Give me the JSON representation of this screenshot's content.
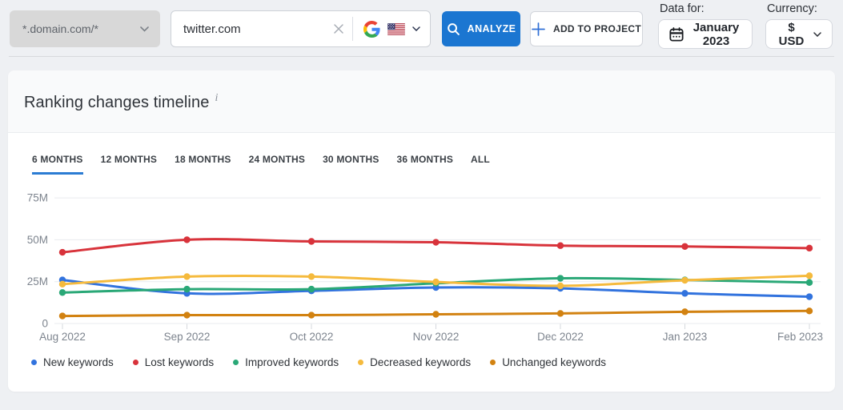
{
  "topbar": {
    "domain_filter": {
      "value": "*.domain.com/*"
    },
    "search": {
      "value": "twitter.com"
    },
    "search_engine": {
      "engine_icon": "google-icon",
      "region_icon": "us-flag-icon"
    },
    "analyze_button": "ANALYZE",
    "add_to_project_button": "ADD TO PROJECT",
    "data_for": {
      "label": "Data for:",
      "value": "January 2023"
    },
    "currency": {
      "label": "Currency:",
      "value": "$ USD"
    }
  },
  "panel": {
    "title": "Ranking changes timeline",
    "info_mark": "i",
    "tabs": [
      {
        "label": "6 MONTHS",
        "active": true
      },
      {
        "label": "12 MONTHS",
        "active": false
      },
      {
        "label": "18 MONTHS",
        "active": false
      },
      {
        "label": "24 MONTHS",
        "active": false
      },
      {
        "label": "30 MONTHS",
        "active": false
      },
      {
        "label": "36 MONTHS",
        "active": false
      },
      {
        "label": "ALL",
        "active": false
      }
    ]
  },
  "chart_data": {
    "type": "line",
    "title": "Ranking changes timeline",
    "unit": "millions of keywords",
    "x": [
      "Aug 2022",
      "Sep 2022",
      "Oct 2022",
      "Nov 2022",
      "Dec 2022",
      "Jan 2023",
      "Feb 2023"
    ],
    "ylim": [
      0,
      75
    ],
    "y_ticks": [
      {
        "label": "75M",
        "value": 75
      },
      {
        "label": "50M",
        "value": 50
      },
      {
        "label": "25M",
        "value": 25
      },
      {
        "label": "0",
        "value": 0
      }
    ],
    "grid": "horizontal",
    "legend_position": "bottom",
    "series": [
      {
        "name": "New keywords",
        "color": "#3273de",
        "values": [
          26,
          18,
          19.5,
          21.5,
          21,
          18,
          16
        ]
      },
      {
        "name": "Lost keywords",
        "color": "#d8333b",
        "values": [
          42.5,
          50,
          49,
          48.5,
          46.5,
          46,
          45
        ]
      },
      {
        "name": "Improved keywords",
        "color": "#2aa877",
        "values": [
          18.5,
          20.5,
          20.5,
          24,
          27,
          26,
          24.5
        ]
      },
      {
        "name": "Decreased keywords",
        "color": "#f5ba3d",
        "values": [
          23.5,
          28,
          28,
          24.8,
          22.5,
          25.8,
          28.5
        ]
      },
      {
        "name": "Unchanged keywords",
        "color": "#d28211",
        "values": [
          4.5,
          5,
          5,
          5.5,
          6,
          7,
          7.5
        ]
      }
    ]
  },
  "colors": {
    "accent_blue": "#1b76d1",
    "tab_underline": "#2b7cd3",
    "axis_text": "#7d848e",
    "gridline": "#e9ebef",
    "page_bg": "#eef0f3"
  }
}
